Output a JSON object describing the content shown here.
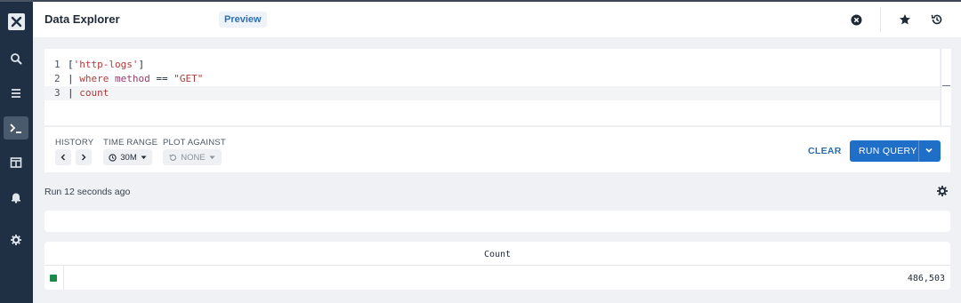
{
  "header": {
    "title": "Data Explorer",
    "badge": "Preview"
  },
  "sidebar": {
    "items": [
      {
        "name": "search"
      },
      {
        "name": "list"
      },
      {
        "name": "terminal",
        "active": true
      },
      {
        "name": "table"
      },
      {
        "name": "bell"
      },
      {
        "name": "settings"
      }
    ]
  },
  "editor": {
    "lines": [
      {
        "num": "1",
        "text": "['http-logs']"
      },
      {
        "num": "2",
        "text": "| where method == \"GET\""
      },
      {
        "num": "3",
        "text": "| count"
      }
    ]
  },
  "controls": {
    "history_label": "HISTORY",
    "time_range_label": "TIME RANGE",
    "time_range_value": "30M",
    "plot_against_label": "PLOT AGAINST",
    "plot_against_value": "NONE",
    "clear_label": "CLEAR",
    "run_label": "RUN QUERY"
  },
  "status": {
    "run_text": "Run 12 seconds ago"
  },
  "results": {
    "column_header": "Count",
    "rows": [
      {
        "color": "#1a8a4a",
        "value": "486,503"
      }
    ]
  },
  "colors": {
    "accent": "#1f6ec8",
    "sidebar_bg": "#1f2f44",
    "series": "#1a8a4a"
  }
}
